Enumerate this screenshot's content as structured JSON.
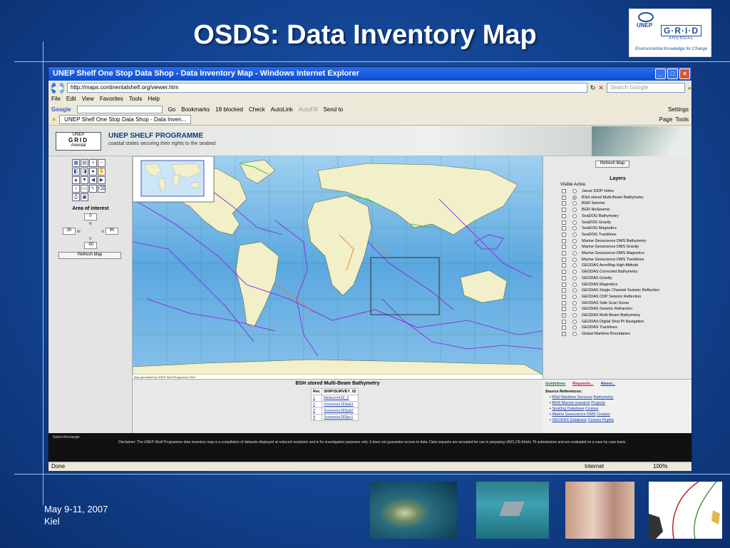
{
  "slide": {
    "title": "OSDS: Data Inventory Map",
    "date": "May 9-11, 2007",
    "location": "Kiel",
    "logo": {
      "text_unep": "UNEP",
      "text_grid": "G·R·I·D",
      "text_arendal": "ARENDAL",
      "tagline": "Environmental Knowledge for Change"
    }
  },
  "browser": {
    "window_title": "UNEP Shelf One Stop Data Shop - Data Inventory Map - Windows Internet Explorer",
    "url": "http://maps.continentalshelf.org/viewer.htm",
    "search_placeholder": "Search Google",
    "menu": [
      "File",
      "Edit",
      "View",
      "Favorites",
      "Tools",
      "Help"
    ],
    "toolbar": {
      "google": "Google",
      "go": "Go",
      "bookmarks": "Bookmarks",
      "blocked": "18 blocked",
      "check": "Check",
      "autolink": "AutoLink",
      "autofill": "AutoFill",
      "send_to": "Send to",
      "settings": "Settings"
    },
    "tab_title": "UNEP Shelf One Stop Data Shop - Data Inven...",
    "tab_tools": {
      "page": "Page",
      "tools": "Tools"
    },
    "status": {
      "left": "Done",
      "zone": "Internet",
      "zoom": "100%"
    }
  },
  "page": {
    "banner": {
      "logo_top": "UNEP",
      "logo_grid": "GRID",
      "logo_bottom": "Arendal",
      "title": "UNEP SHELF PROGRAMME",
      "subtitle": "coastal states securing their rights to the seabed"
    },
    "aoi": {
      "label": "Area of interest",
      "north": "0",
      "west": "30",
      "east": "90",
      "south": "-50",
      "n_label": "N",
      "w_label": "W",
      "e_label": "E",
      "s_label": "S",
      "refresh": "Refresh Map"
    },
    "map_credit": "Map generated by UNEP Shelf Programme 2007",
    "layers": {
      "refresh": "Refresh Map",
      "title": "Layers",
      "header": "Visible Active",
      "items": [
        {
          "label": "Janus IODP Holes",
          "visible": false,
          "active": false
        },
        {
          "label": "BSH stored Multi-Beam Bathymetry",
          "visible": true,
          "active": true
        },
        {
          "label": "BGR Seismic",
          "visible": false,
          "active": false
        },
        {
          "label": "BGR NoSeismic",
          "visible": false,
          "active": false
        },
        {
          "label": "SeaDOG Bathymetry",
          "visible": false,
          "active": false
        },
        {
          "label": "SeaDOG Gravity",
          "visible": false,
          "active": false
        },
        {
          "label": "SeaDOG Magnetics",
          "visible": false,
          "active": false
        },
        {
          "label": "SeaDOG Tracklines",
          "visible": false,
          "active": false
        },
        {
          "label": "Marine Geoscience DMS Bathymetry",
          "visible": false,
          "active": false
        },
        {
          "label": "Marine Geoscience DMS Gravity",
          "visible": false,
          "active": false
        },
        {
          "label": "Marine Geoscience DMS Magnetics",
          "visible": false,
          "active": false
        },
        {
          "label": "Marine Geoscience DMS Tracklines",
          "visible": false,
          "active": false
        },
        {
          "label": "GEODAS AeroMag High Altitude",
          "visible": false,
          "active": false
        },
        {
          "label": "GEODAS Corrected Bathymetry",
          "visible": false,
          "active": false
        },
        {
          "label": "GEODAS Gravity",
          "visible": false,
          "active": false
        },
        {
          "label": "GEODAS Magnetics",
          "visible": false,
          "active": false
        },
        {
          "label": "GEODAS Single Channel Seismic Reflection",
          "visible": false,
          "active": false
        },
        {
          "label": "GEODAS CDP Seismic Reflection",
          "visible": false,
          "active": false
        },
        {
          "label": "GEODAS Side Scan Sonar",
          "visible": false,
          "active": false
        },
        {
          "label": "GEODAS Seismic Refraction",
          "visible": false,
          "active": false
        },
        {
          "label": "GEODAS Multi-Beam Bathymetry",
          "visible": true,
          "active": false
        },
        {
          "label": "GEODAS Digital Shot Pt Navigation",
          "visible": false,
          "active": false
        },
        {
          "label": "GEODAS Tracklines",
          "visible": false,
          "active": false
        },
        {
          "label": "Global Maritime Boundaries",
          "visible": true,
          "active": false
        }
      ]
    },
    "results": {
      "title": "BSH stored Multi-Beam Bathymetry",
      "col_rec": "Rec",
      "col_id": "SHIP/SURVEY_ID",
      "rows": [
        {
          "rec": "1",
          "id": "Meteor/m33_2"
        },
        {
          "rec": "2",
          "id": "Sonne/so183pb1"
        },
        {
          "rec": "3",
          "id": "Sonne/so183pb2"
        },
        {
          "rec": "4",
          "id": "Sonne/so183pc1"
        }
      ]
    },
    "refs": {
      "guidelines": "Guidelines",
      "requests": "Requests...",
      "about": "About...",
      "header": "Source References:",
      "items": [
        {
          "org": "BSH Maritime Services",
          "link": "Bathymetry"
        },
        {
          "org": "BGR Marine research",
          "link": "Projects"
        },
        {
          "org": "SeaDog Database",
          "link": "Cruises"
        },
        {
          "org": "Marine Geoscience DMS",
          "link": "Cruises"
        },
        {
          "org": "GEODAS Database",
          "link": "Cruises   Flights"
        }
      ]
    },
    "footer": {
      "select_rect": "Select Rectangle",
      "disclaimer": "Disclaimer: The UNEP Shelf Programme data inventory map is a compilation of datasets displayed at reduced resolution and is for investigation purposes only. It does not guarantee access to data. Data requests are accepted for use in preparing UNCLOS Article 76 submissions and are evaluated on a case by case basis."
    }
  }
}
